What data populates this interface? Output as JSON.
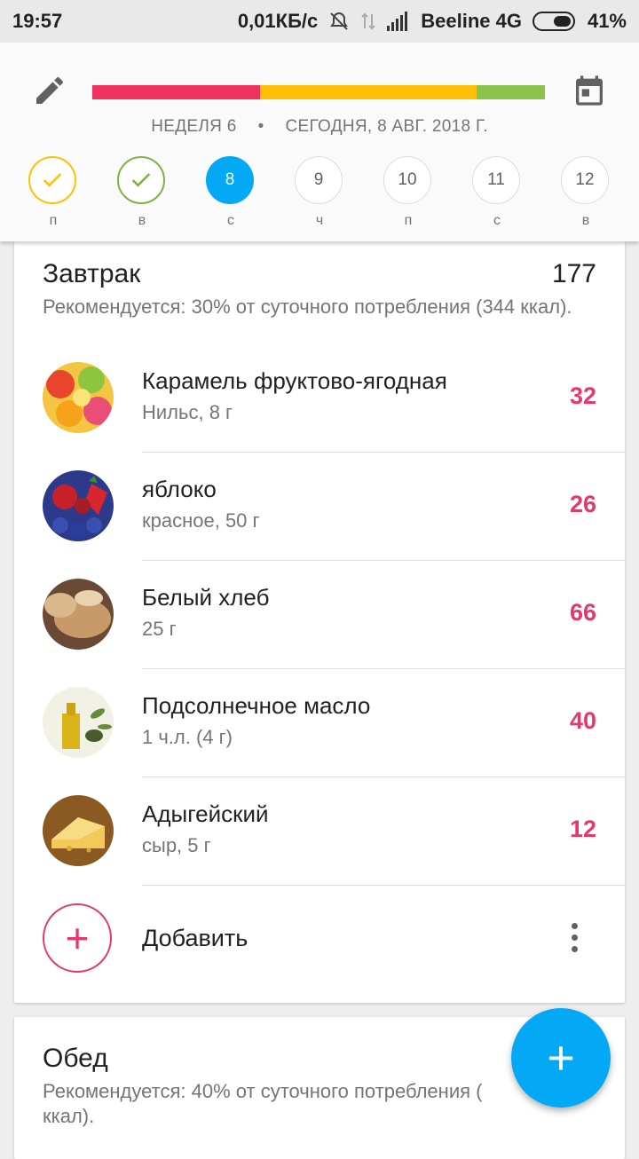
{
  "status_bar": {
    "time": "19:57",
    "speed": "0,01КБ/с",
    "carrier": "Beeline 4G",
    "battery": "41%"
  },
  "header": {
    "week_label": "НЕДЕЛЯ 6",
    "separator": "•",
    "date_label": "СЕГОДНЯ, 8 АВГ. 2018 Г.",
    "progress": [
      {
        "color": "#f0325f",
        "fraction": 0.37
      },
      {
        "color": "#ffc107",
        "fraction": 0.48
      },
      {
        "color": "#8bc34a",
        "fraction": 0.15
      }
    ],
    "days": [
      {
        "label": "п",
        "value": "",
        "state": "done-y"
      },
      {
        "label": "в",
        "value": "",
        "state": "done-g"
      },
      {
        "label": "с",
        "value": "8",
        "state": "today"
      },
      {
        "label": "ч",
        "value": "9",
        "state": "future"
      },
      {
        "label": "п",
        "value": "10",
        "state": "future"
      },
      {
        "label": "с",
        "value": "11",
        "state": "future"
      },
      {
        "label": "в",
        "value": "12",
        "state": "future"
      }
    ]
  },
  "breakfast": {
    "title": "Завтрак",
    "total": "177",
    "recommendation": "Рекомендуется: 30% от суточного потребления (344 ккал).",
    "items": [
      {
        "name": "Карамель фруктово-ягодная",
        "sub": "Нильс, 8 г",
        "kcal": "32",
        "icon": "candy"
      },
      {
        "name": "яблоко",
        "sub": "красное, 50 г",
        "kcal": "26",
        "icon": "berries"
      },
      {
        "name": "Белый хлеб",
        "sub": "25 г",
        "kcal": "66",
        "icon": "bread"
      },
      {
        "name": "Подсолнечное масло",
        "sub": "1 ч.л. (4 г)",
        "kcal": "40",
        "icon": "oil"
      },
      {
        "name": "Адыгейский",
        "sub": "сыр, 5 г",
        "kcal": "12",
        "icon": "cheese"
      }
    ],
    "add_label": "Добавить"
  },
  "lunch": {
    "title": "Обед",
    "recommendation": "Рекомендуется: 40% от суточного потребления (",
    "recommendation_line2": "ккал)."
  },
  "fab_label": "+"
}
